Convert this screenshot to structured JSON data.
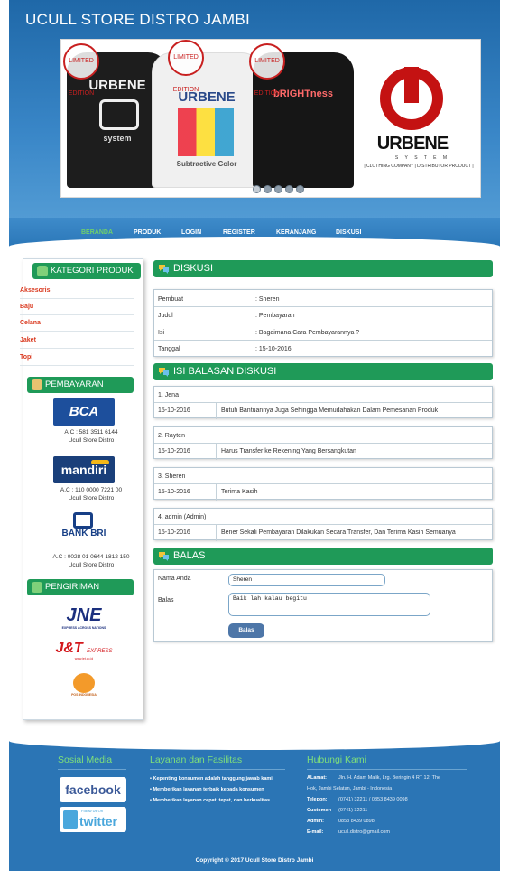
{
  "site": {
    "title": "UCULL STORE DISTRO JAMBI"
  },
  "banner": {
    "shirts": [
      "URBENE",
      "URBENE",
      "bRIGHTness"
    ],
    "shirt_sub": [
      "system",
      "Subtractive Color",
      ""
    ],
    "limited": "LIMITED EDITION",
    "logo_text": "URBENE",
    "logo_sub": "S Y S T E M",
    "logo_sub2": "| CLOTHING COMPANY | DISTRIBUTOR PRODUCT |",
    "slide_count": 5,
    "active_slide": 0
  },
  "nav": {
    "items": [
      "BERANDA",
      "PRODUK",
      "LOGIN",
      "REGISTER",
      "KERANJANG",
      "DISKUSI"
    ],
    "active": "BERANDA"
  },
  "sidebar": {
    "kategori_title": "KATEGORI PRODUK",
    "categories": [
      "Aksesoris",
      "Baju",
      "Celana",
      "Jaket",
      "Topi"
    ],
    "pembayaran_title": "PEMBAYARAN",
    "banks": [
      {
        "name": "BCA",
        "account": "A.C : 581 3511 6144",
        "holder": "Ucull Store Distro"
      },
      {
        "name": "mandiri",
        "account": "A.C : 110 0000 7221 00",
        "holder": "Ucull Store Distro"
      },
      {
        "name": "BANK BRI",
        "account": "A.C : 0028 01 0644 1812 150",
        "holder": "Ucull Store Distro"
      }
    ],
    "pengiriman_title": "PENGIRIMAN",
    "couriers": [
      "JNE",
      "EXPRESS ACROSS NATIONS",
      "J&T",
      "EXPRESS",
      "www.jet.co.id",
      "POS INDONESIA"
    ]
  },
  "diskusi": {
    "title": "DISKUSI",
    "fields": [
      {
        "label": "Pembuat",
        "value": ": Sheren"
      },
      {
        "label": "Judul",
        "value": ": Pembayaran"
      },
      {
        "label": "Isi",
        "value": ": Bagaimana Cara Pembayarannya ?"
      },
      {
        "label": "Tanggal",
        "value": ": 15-10-2016"
      }
    ]
  },
  "balasan": {
    "title": "ISI BALASAN DISKUSI",
    "replies": [
      {
        "author": "1. Jena",
        "date": "15-10-2016",
        "text": "Butuh Bantuannya Juga Sehingga Memudahakan Dalam Pemesanan Produk"
      },
      {
        "author": "2. Rayten",
        "date": "15-10-2016",
        "text": "Harus Transfer ke Rekening Yang Bersangkutan"
      },
      {
        "author": "3. Sheren",
        "date": "15-10-2016",
        "text": "Terima Kasih"
      },
      {
        "author": "4. admin (Admin)",
        "date": "15-10-2016",
        "text": "Bener Sekali Pembayaran Dilakukan Secara Transfer, Dan Terima Kasih Semuanya"
      }
    ]
  },
  "balas": {
    "title": "BALAS",
    "name_label": "Nama Anda",
    "name_value": "Sheren",
    "reply_label": "Balas",
    "reply_value": "Baik lah kalau begitu",
    "submit_label": "Balas"
  },
  "footer": {
    "social_title": "Sosial Media",
    "facebook": "facebook",
    "twitter_follow": "Follow Us On",
    "twitter": "twitter",
    "layanan_title": "Layanan dan Fasilitas",
    "layanan": [
      "Kepenting konsumen adalah tanggung jawab kami",
      "Memberikan layanan terbaik kepada konsumen",
      "Memberikan layanan cepat, tepat, dan berkualitas"
    ],
    "hubungi_title": "Hubungi Kami",
    "contacts": [
      {
        "label": "ALamat:",
        "value": "Jln. H. Adam Malik, Lrg. Beringin 4 RT 12, The"
      },
      {
        "label": "",
        "value": "Hok, Jambi Selatan, Jambi - Indonesia"
      },
      {
        "label": "Telepon:",
        "value": "(0741) 32211 / 0853 8439 0098"
      },
      {
        "label": "Customer:",
        "value": "(0741) 32211"
      },
      {
        "label": "Admin:",
        "value": "0853 8439 0898"
      },
      {
        "label": "E-mail:",
        "value": "ucull.distro@gmail.com"
      }
    ],
    "copyright": "Copyright © 2017 Ucull Store Distro Jambi"
  },
  "colors": {
    "green": "#1f9a58",
    "blue": "#3377b4",
    "nav_active": "#6fd06b",
    "category": "#d9381e"
  }
}
